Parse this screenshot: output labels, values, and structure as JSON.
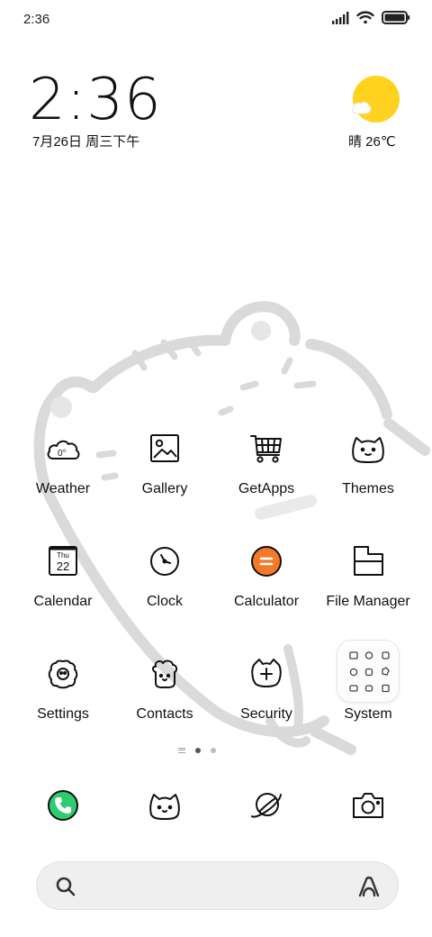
{
  "status_bar": {
    "time": "2:36",
    "icons": [
      "signal-icon",
      "wifi-icon",
      "battery-icon"
    ]
  },
  "clock_widget": {
    "time": "2:36",
    "date": "7月26日 周三下午"
  },
  "weather_widget": {
    "condition_temp": "晴 26℃",
    "icon": "sun-cloud-icon",
    "sun_color": "#FFD21F"
  },
  "apps": [
    {
      "label": "Weather",
      "icon": "weather-cloud-icon"
    },
    {
      "label": "Gallery",
      "icon": "gallery-icon"
    },
    {
      "label": "GetApps",
      "icon": "shopping-cart-icon"
    },
    {
      "label": "Themes",
      "icon": "cat-face-icon"
    },
    {
      "label": "Calendar",
      "icon": "calendar-icon",
      "icon_day": "Thu",
      "icon_date": "22"
    },
    {
      "label": "Clock",
      "icon": "clock-icon"
    },
    {
      "label": "Calculator",
      "icon": "calculator-icon",
      "accent": "#F37A2A"
    },
    {
      "label": "File Manager",
      "icon": "folder-icon"
    },
    {
      "label": "Settings",
      "icon": "settings-gear-icon"
    },
    {
      "label": "Contacts",
      "icon": "contacts-icon"
    },
    {
      "label": "Security",
      "icon": "security-shield-icon"
    },
    {
      "label": "System",
      "icon": "system-folder-icon"
    }
  ],
  "weather_icon_text": "0°",
  "page_indicator": {
    "pages": 2,
    "active": 1
  },
  "dock": [
    {
      "name": "phone",
      "icon": "phone-icon",
      "accent": "#2ECC71"
    },
    {
      "name": "messages",
      "icon": "messages-cat-icon"
    },
    {
      "name": "browser",
      "icon": "browser-planet-icon"
    },
    {
      "name": "camera",
      "icon": "camera-icon"
    }
  ],
  "search_bar": {
    "placeholder": "",
    "icon": "search-icon",
    "assistant_icon": "assistant-icon"
  }
}
